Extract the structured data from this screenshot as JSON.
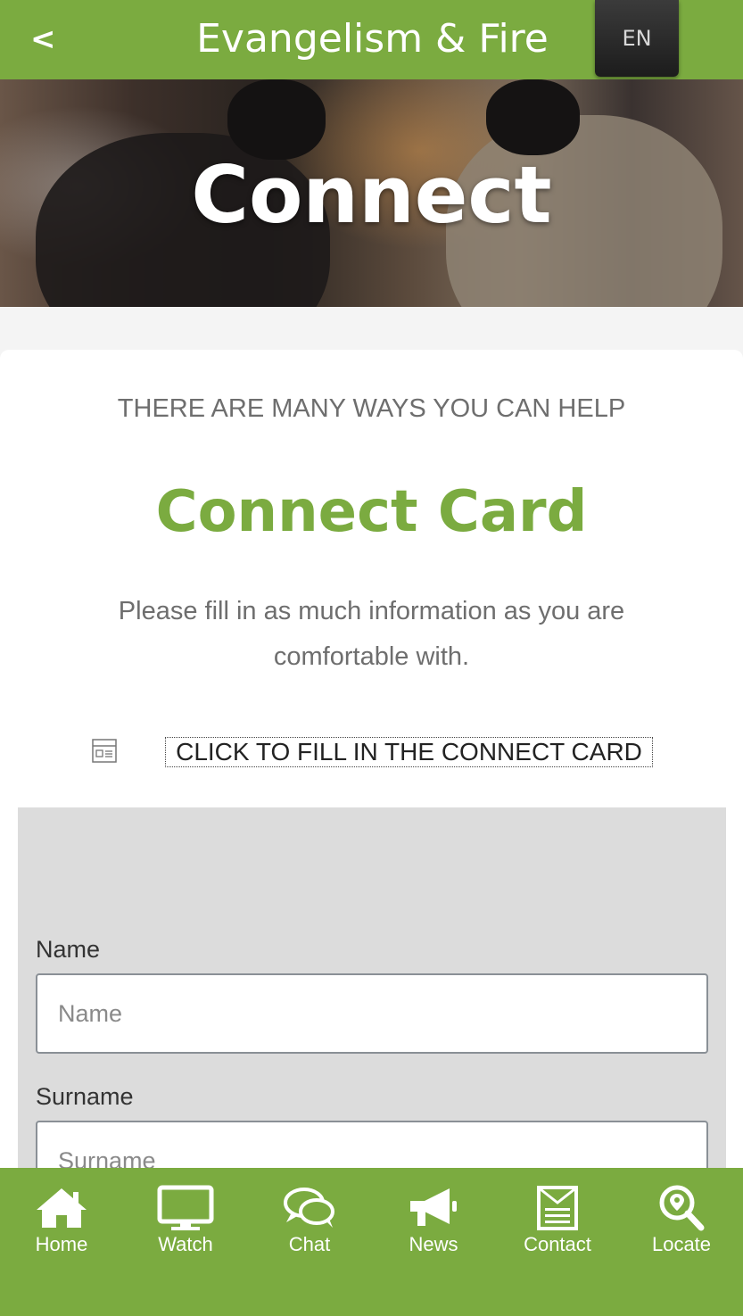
{
  "header": {
    "back_label": "<",
    "title": "Evangelism & Fire",
    "language": "EN"
  },
  "hero": {
    "title": "Connect"
  },
  "content": {
    "kicker": "THERE ARE MANY WAYS YOU CAN HELP",
    "heading": "Connect Card",
    "intro": "Please fill in as much information as you are comfortable with.",
    "cta": {
      "icon": "form-icon",
      "label": "CLICK TO FILL IN THE CONNECT CARD"
    }
  },
  "form": {
    "fields": [
      {
        "label": "Name",
        "placeholder": "Name"
      },
      {
        "label": "Surname",
        "placeholder": "Surname"
      }
    ]
  },
  "bottom_nav": {
    "items": [
      {
        "label": "Home",
        "icon": "home-icon"
      },
      {
        "label": "Watch",
        "icon": "monitor-icon"
      },
      {
        "label": "Chat",
        "icon": "chat-icon"
      },
      {
        "label": "News",
        "icon": "megaphone-icon"
      },
      {
        "label": "Contact",
        "icon": "contact-icon"
      },
      {
        "label": "Locate",
        "icon": "locate-icon"
      }
    ]
  },
  "colors": {
    "accent": "#7bab40",
    "language_button": "#2a2a2a"
  }
}
